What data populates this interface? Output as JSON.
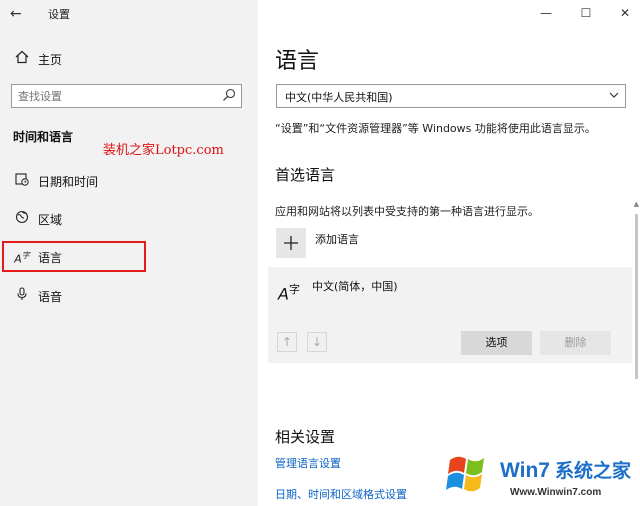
{
  "window": {
    "title": "设置"
  },
  "sidebar": {
    "home": {
      "label": "主页",
      "icon": "home-icon"
    },
    "search": {
      "placeholder": "查找设置"
    },
    "section_title": "时间和语言",
    "items": [
      {
        "label": "日期和时间",
        "icon": "date-time-icon"
      },
      {
        "label": "区域",
        "icon": "region-icon"
      },
      {
        "label": "语言",
        "icon": "language-icon",
        "selected": true
      },
      {
        "label": "语音",
        "icon": "microphone-icon"
      }
    ]
  },
  "watermark": {
    "red_text": "装机之家Lotpc.com",
    "logo_cn": "系统之家",
    "logo_win": "Win7",
    "logo_url": "Www.Winwin7.com"
  },
  "main": {
    "page_title": "语言",
    "display_language": {
      "value": "中文(中华人民共和国)"
    },
    "display_language_desc": "“设置”和“文件资源管理器”等 Windows 功能将使用此语言显示。",
    "preferred": {
      "heading": "首选语言",
      "description": "应用和网站将以列表中受支持的第一种语言进行显示。",
      "add_label": "添加语言",
      "language_name": "中文(简体，中国)",
      "options_label": "选项",
      "remove_label": "删除"
    },
    "related": {
      "heading": "相关设置",
      "links": [
        "管理语言设置",
        "日期、时间和区域格式设置"
      ]
    }
  },
  "colors": {
    "accent_link": "#0b63c4",
    "highlight": "#e21b1b",
    "sidebar_bg": "#f2f2f2"
  }
}
